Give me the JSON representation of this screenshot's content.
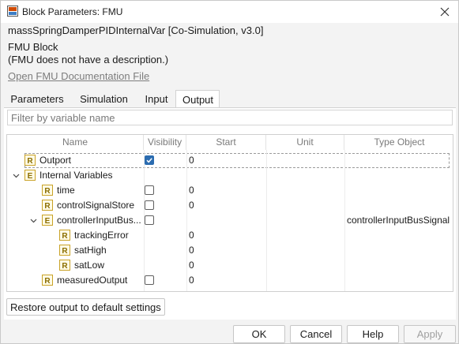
{
  "window": {
    "title": "Block Parameters: FMU",
    "icon": "simulink-block-icon"
  },
  "header": {
    "model_line": "massSpringDamperPIDInternalVar [Co-Simulation, v3.0]",
    "block_name": "FMU Block",
    "description": "(FMU does not have a description.)",
    "doc_link": "Open FMU Documentation File"
  },
  "tabs": [
    {
      "label": "Parameters",
      "active": false
    },
    {
      "label": "Simulation",
      "active": false
    },
    {
      "label": "Input",
      "active": false
    },
    {
      "label": "Output",
      "active": true
    }
  ],
  "filter": {
    "placeholder": "Filter by variable name",
    "value": ""
  },
  "table": {
    "columns": [
      "Name",
      "Visibility",
      "Start",
      "Unit",
      "Type Object"
    ],
    "rows": [
      {
        "name": "Outport",
        "icon": "R",
        "checked": true,
        "start": "0",
        "type": "",
        "selected": true
      },
      {
        "name": "Internal Variables",
        "icon": "E",
        "expand": "collapse"
      },
      {
        "name": "time",
        "icon": "R",
        "checked": false,
        "start": "0",
        "type": ""
      },
      {
        "name": "controlSignalStore",
        "icon": "R",
        "checked": false,
        "start": "0",
        "type": ""
      },
      {
        "name": "controllerInputBus...",
        "icon": "E",
        "expand": "collapse",
        "checked": false,
        "start": "",
        "type": "controllerInputBusSignal"
      },
      {
        "name": "trackingError",
        "icon": "R",
        "start": "0",
        "type": ""
      },
      {
        "name": "satHigh",
        "icon": "R",
        "start": "0",
        "type": ""
      },
      {
        "name": "satLow",
        "icon": "R",
        "start": "0",
        "type": ""
      },
      {
        "name": "measuredOutput",
        "icon": "R",
        "checked": false,
        "start": "0",
        "type": ""
      }
    ]
  },
  "restore_label": "Restore output to default settings",
  "buttons": {
    "ok": "OK",
    "cancel": "Cancel",
    "help": "Help",
    "apply": "Apply"
  },
  "colors": {
    "accent": "#2b6cb0",
    "icon_r": "#c9a227",
    "icon_e": "#b08a1d"
  }
}
